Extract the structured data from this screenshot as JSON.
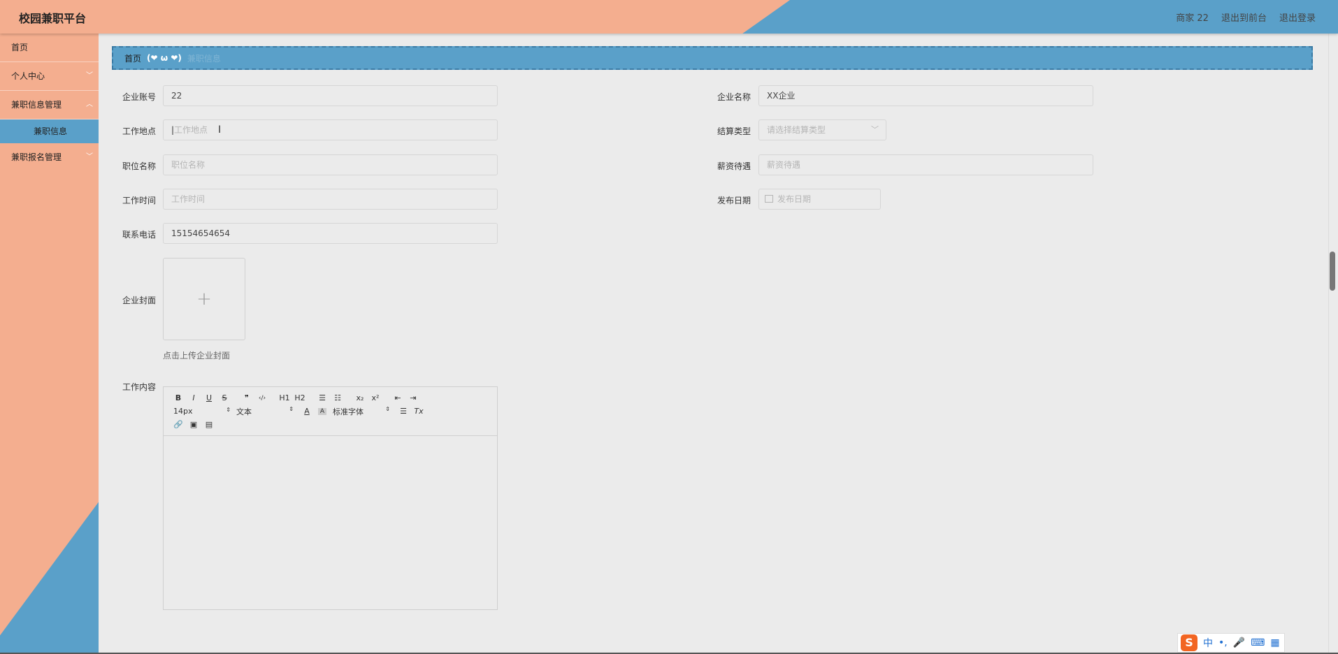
{
  "header": {
    "title": "校园兼职平台",
    "user": "商家 22",
    "to_front": "退出到前台",
    "logout": "退出登录"
  },
  "sidebar": {
    "items": [
      {
        "label": "首页"
      },
      {
        "label": "个人中心"
      },
      {
        "label": "兼职信息管理"
      },
      {
        "label": "兼职信息"
      },
      {
        "label": "兼职报名管理"
      }
    ]
  },
  "breadcrumb": {
    "home": "首页",
    "face": "(❤ ω ❤)",
    "current": "兼职信息"
  },
  "form": {
    "account": {
      "label": "企业账号",
      "value": "22"
    },
    "name": {
      "label": "企业名称",
      "value": "XX企业"
    },
    "location": {
      "label": "工作地点",
      "placeholder": "工作地点"
    },
    "settle": {
      "label": "结算类型",
      "placeholder": "请选择结算类型"
    },
    "position": {
      "label": "职位名称",
      "placeholder": "职位名称"
    },
    "salary": {
      "label": "薪资待遇",
      "placeholder": "薪资待遇"
    },
    "worktime": {
      "label": "工作时间",
      "placeholder": "工作时间"
    },
    "pubdate": {
      "label": "发布日期",
      "placeholder": "发布日期"
    },
    "phone": {
      "label": "联系电话",
      "value": "15154654654"
    },
    "cover": {
      "label": "企业封面",
      "tip": "点击上传企业封面"
    },
    "content": {
      "label": "工作内容"
    }
  },
  "editor": {
    "row1": [
      "B",
      "I",
      "U",
      "S",
      "❞",
      "‹/›",
      "H1",
      "H2",
      "☰",
      "☷",
      "x₂",
      "x²",
      "⇤",
      "⇥"
    ],
    "size": "14px",
    "heading": "文本",
    "font": "标准字体",
    "clear": "Tx"
  },
  "ime": {
    "mode": "中",
    "punct": "•,"
  }
}
